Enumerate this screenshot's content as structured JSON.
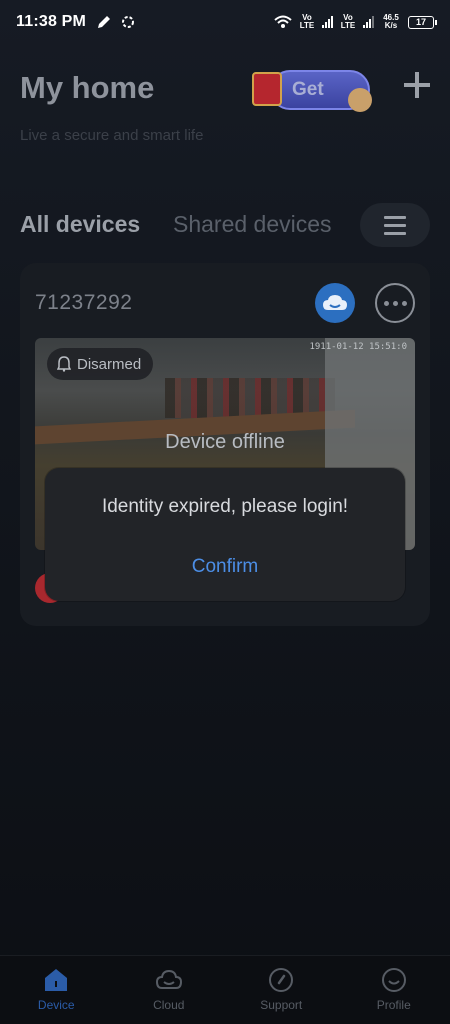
{
  "status_bar": {
    "time": "11:38 PM",
    "net1": "Vo LTE",
    "net2": "Vo LTE",
    "speed": "46.5 K/s",
    "battery": "17"
  },
  "header": {
    "title": "My home",
    "subtitle": "Live a secure and smart life",
    "promo_label": "Get"
  },
  "tabs": {
    "all": "All devices",
    "shared": "Shared devices"
  },
  "device": {
    "name": "71237292",
    "armed_state": "Disarmed",
    "status": "Device offline",
    "timestamp": "1911-01-12 15:51:0"
  },
  "dialog": {
    "message": "Identity expired, please login!",
    "confirm": "Confirm"
  },
  "nav": {
    "items": [
      {
        "label": "Device",
        "icon": "house-icon",
        "active": true
      },
      {
        "label": "Cloud",
        "icon": "cloud-icon",
        "active": false
      },
      {
        "label": "Support",
        "icon": "compass-icon",
        "active": false
      },
      {
        "label": "Profile",
        "icon": "smiley-icon",
        "active": false
      }
    ]
  },
  "colors": {
    "accent": "#4c8ee6",
    "nav_active": "#2b5ca8",
    "cloud_button": "#2c6fc0"
  }
}
